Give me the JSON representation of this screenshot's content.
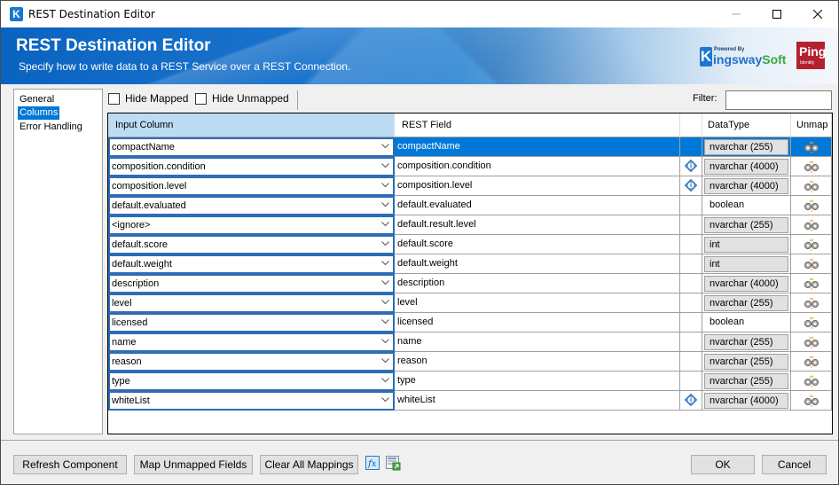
{
  "window": {
    "title": "REST Destination Editor",
    "controls": {
      "minimize": "minimize",
      "maximize": "maximize",
      "close": "close"
    }
  },
  "banner": {
    "title": "REST Destination Editor",
    "subtitle": "Specify how to write data to a REST Service over a REST Connection.",
    "kingsway_powered": "Powered By",
    "kingsway_k": "K",
    "kingsway_ings": "ingsway",
    "kingsway_soft": "Soft",
    "ping_text": "Ping",
    "ping_sub": "Identity"
  },
  "nav": {
    "items": [
      {
        "label": "General",
        "selected": false
      },
      {
        "label": "Columns",
        "selected": true
      },
      {
        "label": "Error Handling",
        "selected": false
      }
    ]
  },
  "toolbar": {
    "hide_mapped": "Hide Mapped",
    "hide_unmapped": "Hide Unmapped",
    "filter_label": "Filter:",
    "filter_value": ""
  },
  "grid": {
    "headers": {
      "input": "Input Column",
      "rest": "REST Field",
      "info": "",
      "dtype": "DataType",
      "unmap": "Unmap"
    },
    "rows": [
      {
        "input": "compactName",
        "rest": "compactName",
        "info": false,
        "dtype": "nvarchar (255)",
        "dtype_editable": true,
        "selected": true
      },
      {
        "input": "composition.condition",
        "rest": "composition.condition",
        "info": true,
        "dtype": "nvarchar (4000)",
        "dtype_editable": true,
        "selected": false
      },
      {
        "input": "composition.level",
        "rest": "composition.level",
        "info": true,
        "dtype": "nvarchar (4000)",
        "dtype_editable": true,
        "selected": false
      },
      {
        "input": "default.evaluated",
        "rest": "default.evaluated",
        "info": false,
        "dtype": "boolean",
        "dtype_editable": false,
        "selected": false
      },
      {
        "input": "<ignore>",
        "rest": "default.result.level",
        "info": false,
        "dtype": "nvarchar (255)",
        "dtype_editable": true,
        "selected": false
      },
      {
        "input": "default.score",
        "rest": "default.score",
        "info": false,
        "dtype": "int",
        "dtype_editable": true,
        "selected": false
      },
      {
        "input": "default.weight",
        "rest": "default.weight",
        "info": false,
        "dtype": "int",
        "dtype_editable": true,
        "selected": false
      },
      {
        "input": "description",
        "rest": "description",
        "info": false,
        "dtype": "nvarchar (4000)",
        "dtype_editable": true,
        "selected": false
      },
      {
        "input": "level",
        "rest": "level",
        "info": false,
        "dtype": "nvarchar (255)",
        "dtype_editable": true,
        "selected": false
      },
      {
        "input": "licensed",
        "rest": "licensed",
        "info": false,
        "dtype": "boolean",
        "dtype_editable": false,
        "selected": false
      },
      {
        "input": "name",
        "rest": "name",
        "info": false,
        "dtype": "nvarchar (255)",
        "dtype_editable": true,
        "selected": false
      },
      {
        "input": "reason",
        "rest": "reason",
        "info": false,
        "dtype": "nvarchar (255)",
        "dtype_editable": true,
        "selected": false
      },
      {
        "input": "type",
        "rest": "type",
        "info": false,
        "dtype": "nvarchar (255)",
        "dtype_editable": true,
        "selected": false
      },
      {
        "input": "whiteList",
        "rest": "whiteList",
        "info": true,
        "dtype": "nvarchar (4000)",
        "dtype_editable": true,
        "selected": false
      }
    ]
  },
  "footer": {
    "refresh": "Refresh Component",
    "map_unmapped": "Map Unmapped Fields",
    "clear_all": "Clear All Mappings",
    "fx_icon": "expression-icon",
    "mapping_icon": "mapping-table-icon",
    "ok": "OK",
    "cancel": "Cancel"
  },
  "colors": {
    "selection": "#0078d7",
    "header_input_bg": "#bcdcf4",
    "input_border": "#2d6db5",
    "banner_blue": "#0a63c0"
  }
}
